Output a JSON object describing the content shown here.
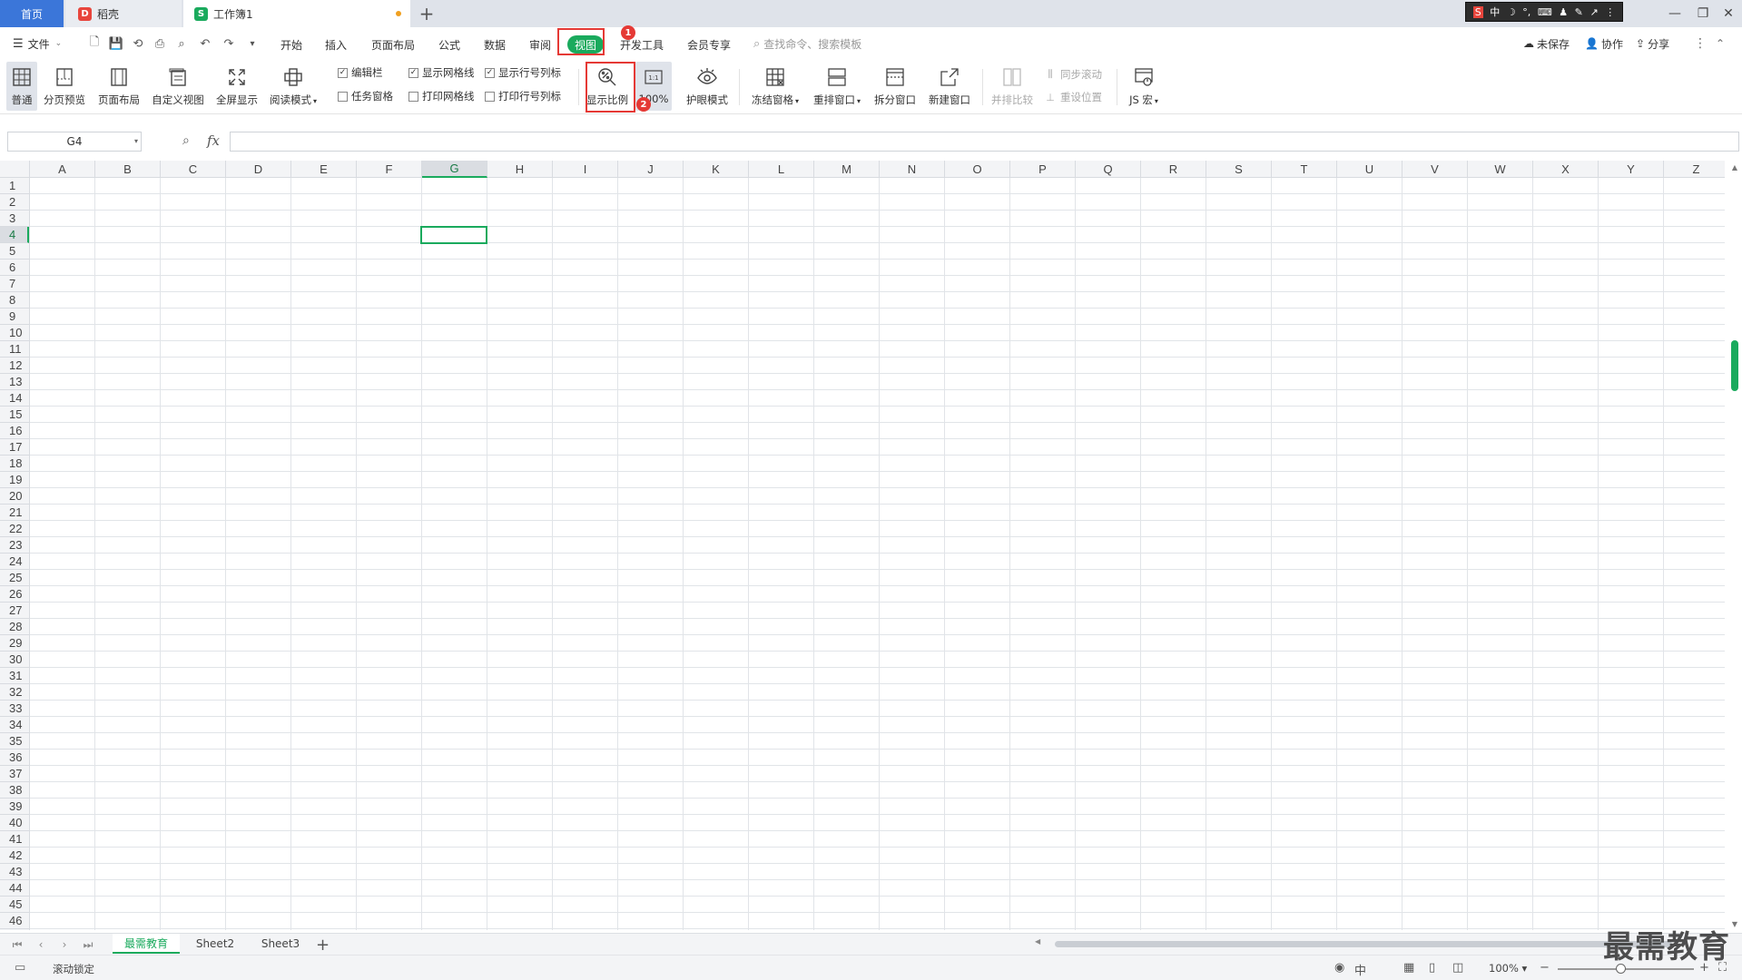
{
  "tabs": {
    "home": "首页",
    "docer": "稻壳",
    "workbook": "工作簿1",
    "add": "+"
  },
  "ime": [
    "S",
    "中",
    "☽",
    "°,",
    "⌨",
    "♟",
    "✎",
    "↗",
    "⋮"
  ],
  "window": {
    "minimize": "—",
    "restore": "❐",
    "close": "✕"
  },
  "menubar": {
    "file": "文件",
    "tabs": [
      "开始",
      "插入",
      "页面布局",
      "公式",
      "数据",
      "审阅",
      "视图",
      "开发工具",
      "会员专享"
    ],
    "search_placeholder": "查找命令、搜索模板",
    "unsaved": "未保存",
    "collaborate": "协作",
    "share": "分享"
  },
  "annotations": {
    "badge1": "1",
    "badge2": "2"
  },
  "ribbon": {
    "normal": "普通",
    "page_break_preview": "分页预览",
    "page_layout": "页面布局",
    "custom_view": "自定义视图",
    "fullscreen": "全屏显示",
    "reading_mode": "阅读模式",
    "edit_bar": "编辑栏",
    "task_pane": "任务窗格",
    "show_gridlines": "显示网格线",
    "print_gridlines": "打印网格线",
    "show_row_col_headers": "显示行号列标",
    "print_row_col_headers": "打印行号列标",
    "zoom_ratio": "显示比例",
    "zoom_100": "100%",
    "eye_protection": "护眼模式",
    "freeze_panes": "冻结窗格",
    "arrange_window": "重排窗口",
    "split_window": "拆分窗口",
    "new_window": "新建窗口",
    "side_by_side": "并排比较",
    "sync_scroll": "同步滚动",
    "reset_position": "重设位置",
    "js_macro": "JS 宏"
  },
  "formula": {
    "namebox": "G4",
    "fx": "fx"
  },
  "columns": [
    "A",
    "B",
    "C",
    "D",
    "E",
    "F",
    "G",
    "H",
    "I",
    "J",
    "K",
    "L",
    "M",
    "N",
    "O",
    "P",
    "Q",
    "R",
    "S",
    "T",
    "U",
    "V",
    "W",
    "X",
    "Y",
    "Z"
  ],
  "selected_column": "G",
  "selected_row": 4,
  "row_count": 46,
  "sheets": [
    "最需教育",
    "Sheet2",
    "Sheet3"
  ],
  "status": {
    "scroll_lock": "滚动锁定",
    "zoom": "100%",
    "watermark": "最需教育"
  },
  "colors": {
    "accent": "#1aaa5d",
    "tab_home": "#3b76d9",
    "annotation": "#e53935"
  }
}
